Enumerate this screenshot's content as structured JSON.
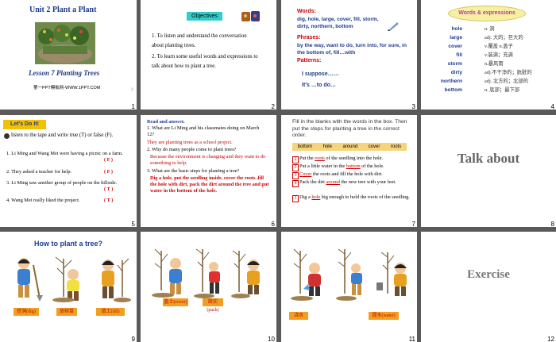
{
  "slides": [
    {
      "num": "1",
      "title": "Unit 2  Plant a Plant",
      "lesson": "Lesson 7   Planting Trees",
      "site": "第一PPT模板网-WWW.1PPT.COM"
    },
    {
      "num": "2",
      "heading": "Objectives",
      "items": [
        "1. To listen and understand the conversation about planting trees.",
        "2. To learn some useful words and expressions to talk about how to plant a tree."
      ]
    },
    {
      "num": "3",
      "words_label": "Words:",
      "words": "dig, hole, large, cover, fill, storm, dirty, northern, bottom",
      "phrases_label": "Phrases:",
      "phrases": "by the way, want to do, turn into, for sure, in the bottom of, fill…with",
      "patterns_label": "Patterns:",
      "p1": "I suppose……",
      "p2": "It's …to do…"
    },
    {
      "num": "4",
      "heading": "Words & expressions",
      "vocab": [
        {
          "en": "hole",
          "zh": "n. 洞"
        },
        {
          "en": "large",
          "zh": "adj. 大的；巨大的"
        },
        {
          "en": "cover",
          "zh": "v.覆盖  n.盖子"
        },
        {
          "en": "fill",
          "zh": "v.装满；充满"
        },
        {
          "en": "storm",
          "zh": "n.暴风雨"
        },
        {
          "en": "dirty",
          "zh": "adj.不干净的；肮脏的"
        },
        {
          "en": "northern",
          "zh": "adj. 北方的；北部的"
        },
        {
          "en": "bottom",
          "zh": "n. 底部；最下部"
        }
      ]
    },
    {
      "num": "5",
      "banner": "Let's Do It!",
      "instr": "listen to the tape  and write true (T) or false (F).",
      "stmts": [
        {
          "text": "1. Li Ming and Wang Mei were having a picnic on a farm.",
          "ans": "( F )"
        },
        {
          "text": "2. They asked a teacher for help.",
          "ans": "( F )"
        },
        {
          "text": "3. Li Ming saw another group of people on the hillside.",
          "ans": "( T )"
        },
        {
          "text": "4. Wang Mei really liked the project.",
          "ans": "( T )"
        }
      ]
    },
    {
      "num": "6",
      "read": "Read and answer.",
      "q1": "1. What are Li Ming and his classmates doing on March 12?",
      "a1": "They are planting  trees as a school project.",
      "q2": "2. Why do many people  come to plant trees?",
      "a2": "Because the environment  is changing and they want to do something to help.",
      "q3": "3. What are the basic steps for planting a tree?",
      "a3": "Dig a hole, put the seedling inside, cover the roots ,fill the hole with dirt, pack the dirt around the tree and put water in the bottom of the hole."
    },
    {
      "num": "7",
      "instr": "Fill in the blanks with the words in the box. Then put the steps for planting a tree in the correct order.",
      "box": [
        "bottom",
        "hole",
        "around",
        "cover",
        "roots"
      ],
      "steps": [
        {
          "n": "2",
          "pre": "Put the ",
          "blank": "roots",
          "post": " of the seedling into the hole."
        },
        {
          "n": "5",
          "pre": "Put a little water in the ",
          "blank": "bottom",
          "post": " of the hole."
        },
        {
          "n": "3",
          "pre": "",
          "blank": "Cover",
          "post": " the roots and fill the hole with dirt."
        },
        {
          "n": "4",
          "pre": "Pack the dirt ",
          "blank": "around",
          "post": " the new tree with your feet."
        },
        {
          "n": "1",
          "pre": "Dig a ",
          "blank": "hole",
          "post": " big enough to hold the roots of the seedling."
        }
      ]
    },
    {
      "num": "8",
      "text": "Talk  about"
    },
    {
      "num": "9",
      "title": "How to plant a tree?",
      "labels": [
        "挖洞(dig)",
        "放树苗",
        "填土(fill)"
      ]
    },
    {
      "num": "10",
      "labels": [
        "盖土(cover)",
        "踩实(pack)"
      ]
    },
    {
      "num": "11",
      "labels": [
        "浇水",
        "提水(water)"
      ]
    },
    {
      "num": "12",
      "text": "Exercise"
    }
  ]
}
